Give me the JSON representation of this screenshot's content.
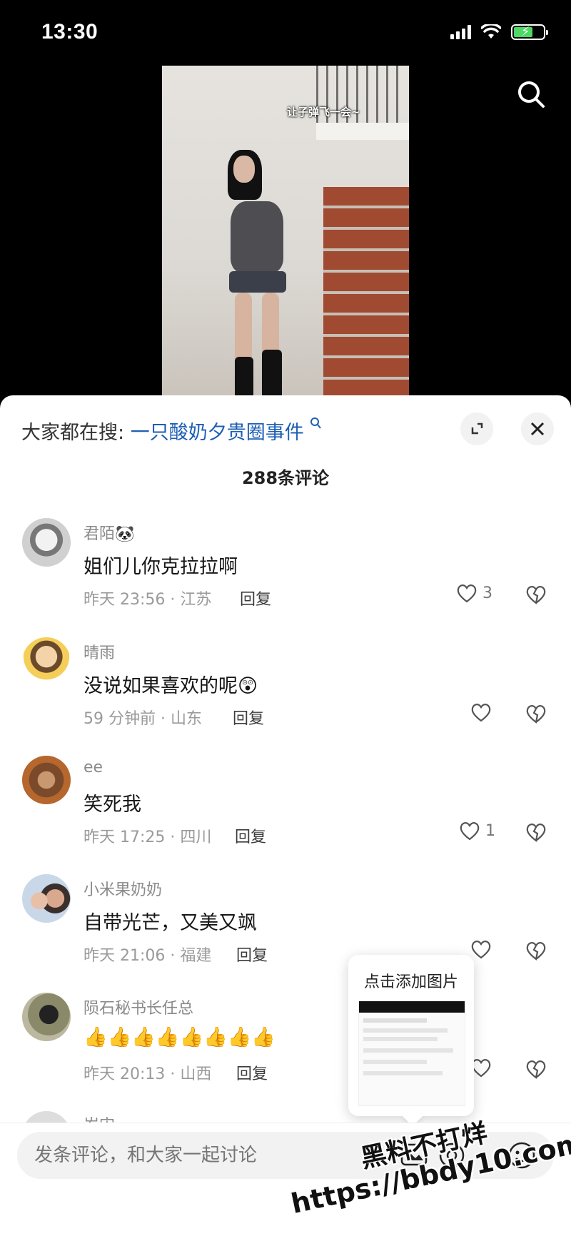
{
  "status": {
    "time": "13:30"
  },
  "video": {
    "caption": "让子弹飞一会~"
  },
  "sheet": {
    "hot_search_prefix": "大家都在搜:",
    "hot_search_term": "一只酸奶夕贵圈事件",
    "comment_count": "288条评论"
  },
  "comments": [
    {
      "name": "君陌🐼",
      "text": "姐们儿你克拉拉啊",
      "meta": "昨天 23:56 · 江苏",
      "reply": "回复",
      "likes": "3"
    },
    {
      "name": "晴雨",
      "text": "没说如果喜欢的呢😲",
      "meta": "59 分钟前 · 山东",
      "reply": "回复",
      "likes": ""
    },
    {
      "name": "ee",
      "text": "笑死我",
      "meta": "昨天 17:25 · 四川",
      "reply": "回复",
      "likes": "1"
    },
    {
      "name": "小米果奶奶",
      "text": "自带光芒，又美又飒",
      "meta": "昨天 21:06 · 福建",
      "reply": "回复",
      "likes": ""
    },
    {
      "name": "陨石秘书长任总",
      "text": "👍👍👍👍👍👍👍👍",
      "meta": "昨天 20:13 · 山西",
      "reply": "回复",
      "likes": ""
    }
  ],
  "partial_next_name": "岁宙",
  "popup": {
    "title": "点击添加图片"
  },
  "input": {
    "placeholder": "发条评论，和大家一起讨论"
  },
  "watermark": {
    "line1": "黑料不打烊",
    "line2": "https://bbdy10.com"
  },
  "colors": {
    "link": "#1e5fb4",
    "battery": "#4cd964"
  }
}
